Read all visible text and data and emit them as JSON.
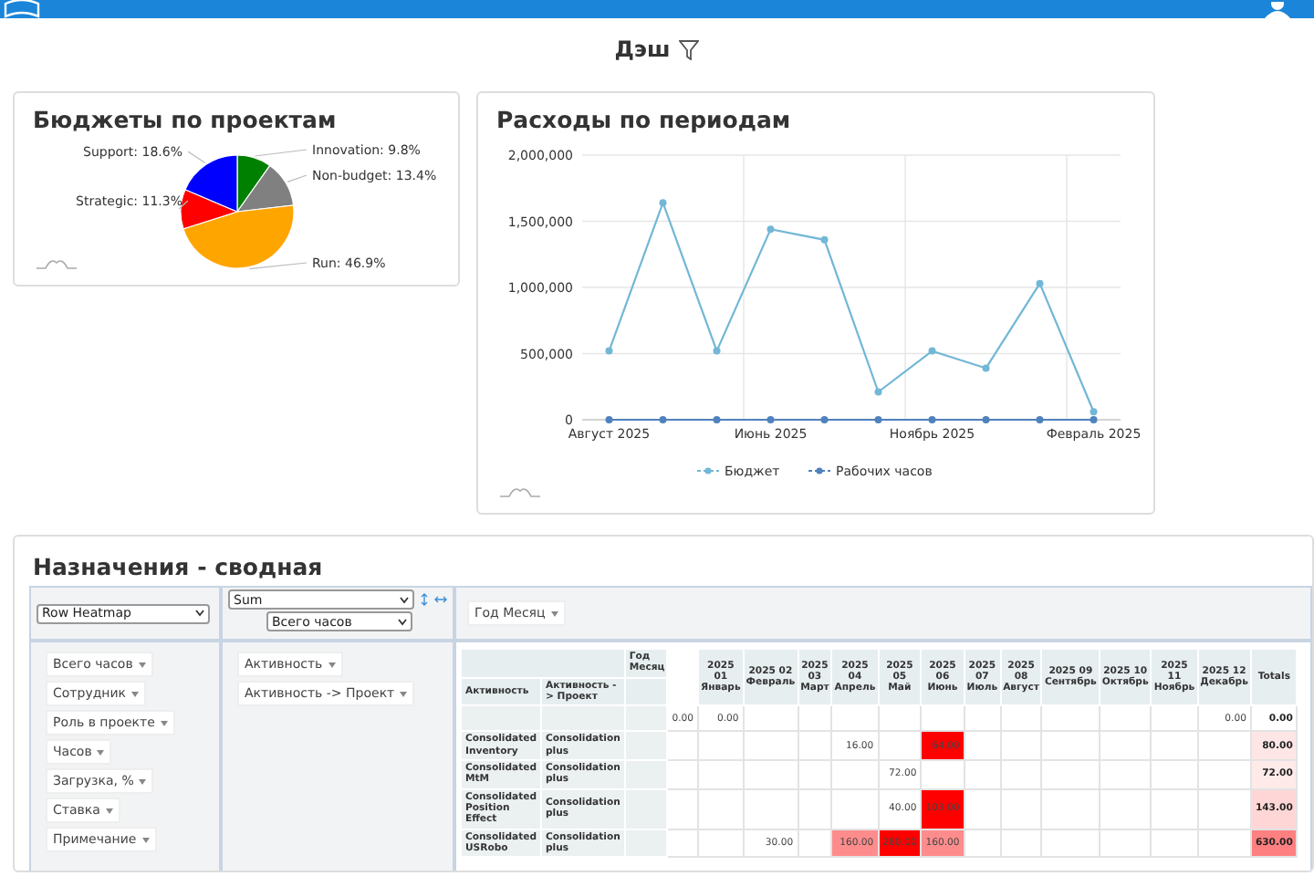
{
  "page_title": "Дэш",
  "budget_card": {
    "chart_data": {
      "type": "pie",
      "title": "Бюджеты по проектам",
      "values": [
        9.8,
        13.4,
        46.9,
        11.3,
        18.6
      ],
      "colors": [
        "#008000",
        "#808080",
        "#ffa500",
        "#ff0000",
        "#0000ff"
      ],
      "value_labels": [
        "Innovation: 9.8%",
        "Non-budget: 13.4%",
        "Run: 46.9%",
        "Strategic: 11.3%",
        "Support: 18.6%"
      ]
    }
  },
  "expense_card": {
    "chart_data": {
      "type": "line",
      "title": "Расходы по периодам",
      "grid": true,
      "legend": true,
      "categories": [
        "Август 2025",
        null,
        null,
        "Июнь 2025",
        null,
        null,
        "Ноябрь 2025",
        null,
        null,
        "Февраль 2025"
      ],
      "ylim": [
        0,
        2000000
      ],
      "yticks": [
        {
          "value": 0,
          "label": "0"
        },
        {
          "value": 500000,
          "label": "500,000"
        },
        {
          "value": 1000000,
          "label": "1,000,000"
        },
        {
          "value": 1500000,
          "label": "1,500,000"
        },
        {
          "value": 2000000,
          "label": "2,000,000"
        }
      ],
      "series": [
        {
          "name": "Бюджет",
          "color": "#72b7d6",
          "marker": "circle",
          "values": [
            520000,
            1640000,
            520000,
            1440000,
            1360000,
            210000,
            520000,
            390000,
            1030000,
            60000
          ]
        },
        {
          "name": "Рабочих часов",
          "color": "#4f81bd",
          "marker": "circle",
          "values": [
            0,
            0,
            0,
            0,
            0,
            0,
            0,
            0,
            0,
            0
          ]
        }
      ]
    }
  },
  "pivot": {
    "title": "Назначения - сводная",
    "renderer": "Row Heatmap",
    "aggregator": "Sum",
    "aggregator_field": "Всего часов",
    "col_fields": [
      "Год Месяц"
    ],
    "unused_fields": [
      "Всего часов",
      "Сотрудник",
      "Роль в проекте",
      "Часов",
      "Загрузка, %",
      "Ставка",
      "Примечание"
    ],
    "row_fields": [
      "Активность",
      "Активность -> Проект"
    ],
    "table": {
      "col_header": "Год Месяц",
      "row_headers": [
        "Активность",
        "Активность -> Проект"
      ],
      "columns": [
        null,
        "2025 01 Январь",
        "2025 02 Февраль",
        "2025 03 Март",
        "2025 04 Апрель",
        "2025 05 Май",
        "2025 06 Июнь",
        "2025 07 Июль",
        "2025 08 Август",
        "2025 09 Сентябрь",
        "2025 10 Октябрь",
        "2025 11 Ноябрь",
        "2025 12 Декабрь"
      ],
      "totals_label": "Totals",
      "rows": [
        {
          "cells": [
            {
              "value": "0.00",
              "color": "#ffffff"
            },
            {
              "value": "0.00",
              "color": "#ffffff"
            },
            null,
            null,
            null,
            null,
            null,
            null,
            null,
            null,
            null,
            null,
            {
              "value": "0.00",
              "color": "#ffffff"
            }
          ],
          "total": {
            "value": "0.00",
            "color": "#ffffff"
          }
        },
        {
          "labels": [
            "Consolidated Inventory",
            "Consolidation plus"
          ],
          "cells": [
            null,
            null,
            null,
            null,
            {
              "value": "16.00",
              "color": "#ffffff"
            },
            null,
            {
              "value": "64.00",
              "color": "#ff0000"
            },
            null,
            null,
            null,
            null,
            null,
            null
          ],
          "total": {
            "value": "80.00",
            "color": "#ffe6e6"
          }
        },
        {
          "labels": [
            "Consolidated MtM",
            "Consolidation plus"
          ],
          "cells": [
            null,
            null,
            null,
            null,
            null,
            {
              "value": "72.00",
              "color": "#ffffff"
            },
            null,
            null,
            null,
            null,
            null,
            null,
            null
          ],
          "total": {
            "value": "72.00",
            "color": "#ffeaea"
          }
        },
        {
          "labels": [
            "Consolidated Position Effect",
            "Consolidation plus"
          ],
          "cells": [
            null,
            null,
            null,
            null,
            null,
            {
              "value": "40.00",
              "color": "#ffffff"
            },
            {
              "value": "103.00",
              "color": "#ff0000"
            },
            null,
            null,
            null,
            null,
            null,
            null
          ],
          "total": {
            "value": "143.00",
            "color": "#ffd6d6"
          }
        },
        {
          "labels": [
            "Consolidated USRobo",
            "Consolidation plus"
          ],
          "cells": [
            null,
            null,
            {
              "value": "30.00",
              "color": "#ffffff"
            },
            null,
            {
              "value": "160.00",
              "color": "#ff8c8c"
            },
            {
              "value": "280.00",
              "color": "#ff0000"
            },
            {
              "value": "160.00",
              "color": "#ff8c8c"
            },
            null,
            null,
            null,
            null,
            null,
            null
          ],
          "total": {
            "value": "630.00",
            "color": "#ff8080"
          }
        }
      ]
    }
  }
}
